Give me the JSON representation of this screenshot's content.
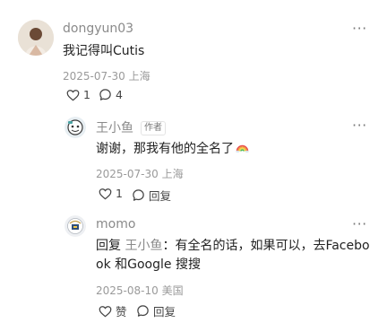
{
  "comments": [
    {
      "username": "dongyun03",
      "text": "我记得叫Cutis",
      "date": "2025-07-30",
      "location": "上海",
      "like_count": "1",
      "reply_count": "4",
      "more_label": "···"
    }
  ],
  "replies": [
    {
      "username": "王小鱼",
      "author_tag": "作者",
      "text": "谢谢，那我有他的全名了",
      "date": "2025-07-30",
      "location": "上海",
      "like_count": "1",
      "reply_label": "回复",
      "more_label": "···"
    },
    {
      "username": "momo",
      "reply_prefix": "回复",
      "mention": "王小鱼",
      "text_line1": "：有全名的话，如果可以，去Facebo",
      "text_line2": "ok 和Google 搜搜",
      "date": "2025-08-10",
      "location": "美国",
      "like_label": "赞",
      "reply_label": "回复",
      "more_label": "···"
    }
  ],
  "colors": {
    "text": "#222222",
    "secondary": "#8a8a8a",
    "icon": "#444444"
  }
}
